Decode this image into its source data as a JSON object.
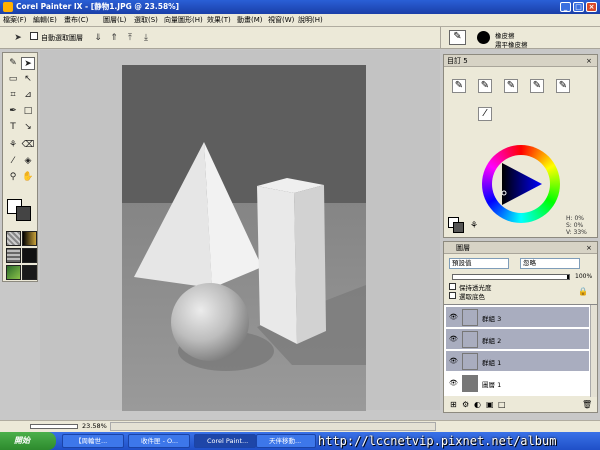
{
  "window": {
    "title": "Corel Painter IX - [静物1.JPG @ 23.58%]"
  },
  "menu": [
    "檔案(F)",
    "編輯(E)",
    "畫布(C)",
    "圖層(L)",
    "選取(S)",
    "向量圖形(H)",
    "效果(T)",
    "動畫(M)",
    "視窗(W)",
    "說明(H)"
  ],
  "property_bar": {
    "auto_select_label": "自動選取圖層"
  },
  "brush_selector": {
    "category": "橡皮擦",
    "variant": "肅平橡皮擦"
  },
  "custom_palette": {
    "title": "目訂 5"
  },
  "color_panel": {
    "h": "H: 0%",
    "s": "S: 0%",
    "v": "V: 33%"
  },
  "layers": {
    "title": "圖層",
    "composite_method": "預設值",
    "composite_depth": "忽略",
    "opacity": "100%",
    "preserve_transparency": "保持透光度",
    "pick_up_color": "選取底色",
    "items": [
      {
        "name": "群組 3",
        "selected": true
      },
      {
        "name": "群組 2",
        "selected": true
      },
      {
        "name": "群組 1",
        "selected": true
      },
      {
        "name": "圖層 1",
        "selected": false
      }
    ]
  },
  "status": {
    "zoom": "23.58%"
  },
  "taskbar": {
    "start_label": "開始",
    "items": [
      "【周輪世...",
      "收件匣 - O...",
      "Corel Paint...",
      "天伴移動..."
    ]
  },
  "watermark": "http://lccnetvip.pixnet.net/album",
  "colors": {
    "accent": "#1a3fa8",
    "panel": "#ece9d8",
    "canvas": "#c3c3c3"
  },
  "icons": [
    "app-icon",
    "minimize-icon",
    "maximize-icon",
    "close-icon",
    "arrow-tool-icon",
    "layer-adjuster-icon",
    "brush-icon",
    "pen-icon",
    "grid-icon",
    "dropper-icon",
    "paintbucket-icon",
    "magnifier-icon",
    "hand-icon",
    "text-icon",
    "eye-icon",
    "lock-icon"
  ]
}
